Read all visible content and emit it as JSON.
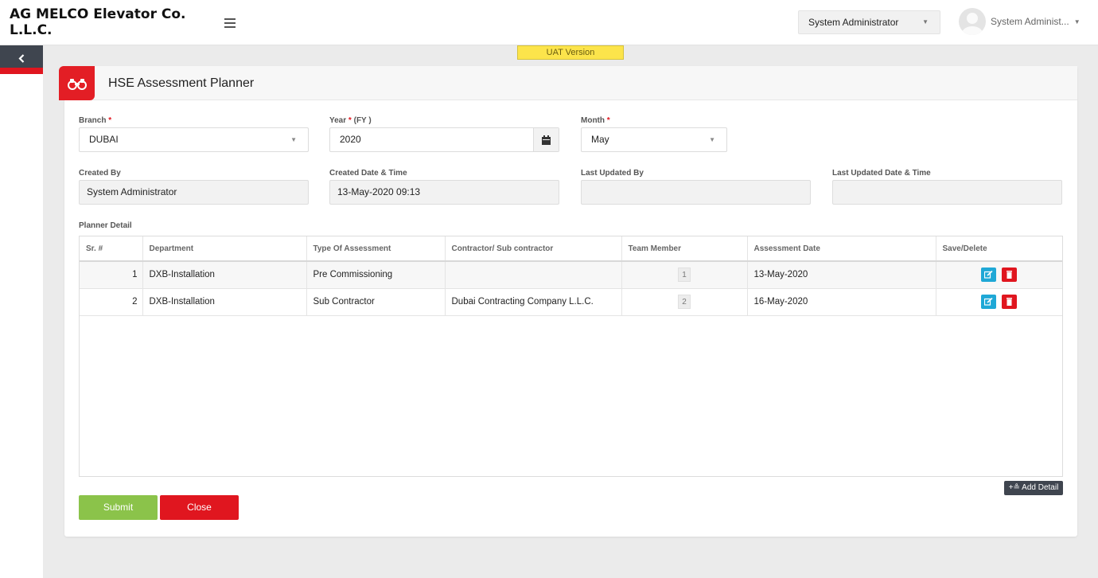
{
  "header": {
    "company": "AG MELCO Elevator Co. L.L.C.",
    "role_selected": "System Administrator",
    "user_name": "System Administ...",
    "uat_badge": "UAT Version"
  },
  "page": {
    "title": "HSE Assessment Planner"
  },
  "form": {
    "branch_label": "Branch",
    "branch_value": "DUBAI",
    "year_label": "Year",
    "year_suffix": "(FY )",
    "year_value": "2020",
    "month_label": "Month",
    "month_value": "May",
    "created_by_label": "Created By",
    "created_by_value": "System Administrator",
    "created_date_label": "Created Date & Time",
    "created_date_value": "13-May-2020 09:13",
    "last_updated_by_label": "Last Updated By",
    "last_updated_by_value": "",
    "last_updated_date_label": "Last Updated Date & Time",
    "last_updated_date_value": "",
    "required_mark": "*"
  },
  "planner": {
    "label": "Planner Detail",
    "columns": [
      "Sr. #",
      "Department",
      "Type Of Assessment",
      "Contractor/ Sub contractor",
      "Team Member",
      "Assessment Date",
      "Save/Delete"
    ],
    "rows": [
      {
        "sr": "1",
        "department": "DXB-Installation",
        "type": "Pre Commissioning",
        "contractor": "",
        "team": "1",
        "date": "13-May-2020"
      },
      {
        "sr": "2",
        "department": "DXB-Installation",
        "type": "Sub Contractor",
        "contractor": "Dubai Contracting Company L.L.C.",
        "team": "2",
        "date": "16-May-2020"
      }
    ],
    "add_detail_label": "Add Detail"
  },
  "actions": {
    "submit_label": "Submit",
    "close_label": "Close"
  },
  "colors": {
    "accent_red": "#e0161f",
    "submit_green": "#8bc34a",
    "edit_blue": "#1fa8d6",
    "uat_yellow": "#fce44b"
  }
}
